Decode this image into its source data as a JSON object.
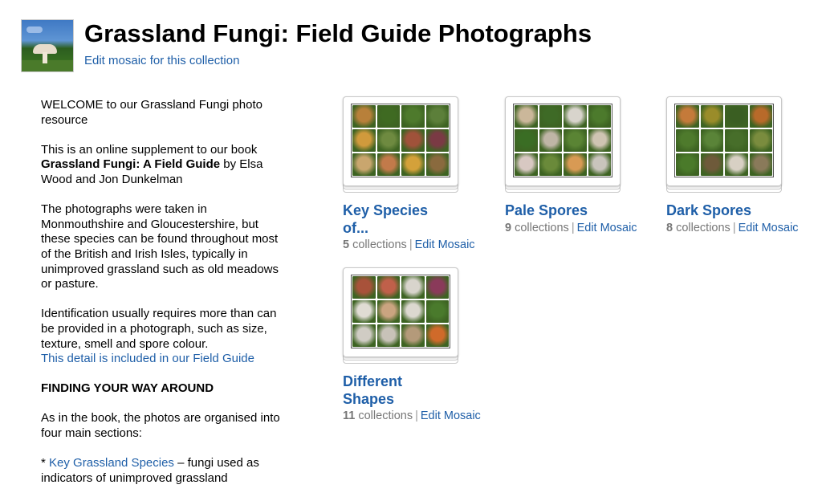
{
  "header": {
    "title": "Grassland Fungi: Field Guide Photographs",
    "edit_mosaic": "Edit mosaic for this collection",
    "cover_icon": "collection-cover-thumbnail"
  },
  "description": {
    "p1": "WELCOME to our Grassland Fungi photo resource",
    "p2_pre": "This is an online supplement to our book ",
    "p2_book": "Grassland Fungi: A Field Guide",
    "p2_post": " by Elsa Wood and Jon Dunkelman",
    "p3": "The photographs were taken in Monmouthshire and Gloucestershire, but these species can be found throughout most of the British and Irish Isles, typically in unimproved grassland such as old meadows or pasture.",
    "p4": "Identification usually requires more than can be provided in a photograph, such as size, texture, smell and spore colour.",
    "p4_link": "This detail is included in our Field Guide",
    "p5": "FINDING YOUR WAY AROUND",
    "p6": "As in the book, the photos are organised into four main sections:",
    "p7_bullet": "* ",
    "p7_link": "Key Grassland Species",
    "p7_post": " – fungi used as indicators of unimproved grassland"
  },
  "sets": [
    {
      "title_line1": "Key Species",
      "title_line2": "of...",
      "count": "5",
      "count_label": " collections",
      "separator": "|",
      "edit_label": "Edit Mosaic",
      "tiles": [
        "#b8803a",
        "#3f6a22",
        "#4e7a2c",
        "#5c7f3a",
        "#d09a3c",
        "#6e8a40",
        "#a0523a",
        "#7a3a44",
        "#c9a66e",
        "#c27a4a",
        "#d4a13a",
        "#8a6a3e"
      ]
    },
    {
      "title_line1": "Pale Spores",
      "title_line2": "",
      "count": "9",
      "count_label": " collections",
      "separator": "|",
      "edit_label": "Edit Mosaic",
      "tiles": [
        "#cbb79a",
        "#3e6a26",
        "#d8d4cc",
        "#4c7a2c",
        "#3a6d24",
        "#bfb5a6",
        "#5a8434",
        "#cfc4b2",
        "#d8c8c2",
        "#6a8a3a",
        "#d89a54",
        "#c9c4bc"
      ]
    },
    {
      "title_line1": "Dark Spores",
      "title_line2": "",
      "count": "8",
      "count_label": " collections",
      "separator": "|",
      "edit_label": "Edit Mosaic",
      "tiles": [
        "#c47a3a",
        "#9a8c2a",
        "#3a5e22",
        "#b86a2a",
        "#4e7a2c",
        "#5a8438",
        "#476e2a",
        "#7a8c3e",
        "#4a7a2a",
        "#6e5a3a",
        "#d8d0c4",
        "#8a7a5a"
      ]
    },
    {
      "title_line1": "Different",
      "title_line2": "Shapes",
      "count": "11",
      "count_label": " collections",
      "separator": "|",
      "edit_label": "Edit Mosaic",
      "tiles": [
        "#a8523a",
        "#c0604a",
        "#d8d4cc",
        "#8a3a5a",
        "#e0dcd4",
        "#caa480",
        "#dcd8d0",
        "#4a7a2c",
        "#d0ccc4",
        "#c8c2b8",
        "#b49a7a",
        "#d06a2a"
      ]
    }
  ]
}
